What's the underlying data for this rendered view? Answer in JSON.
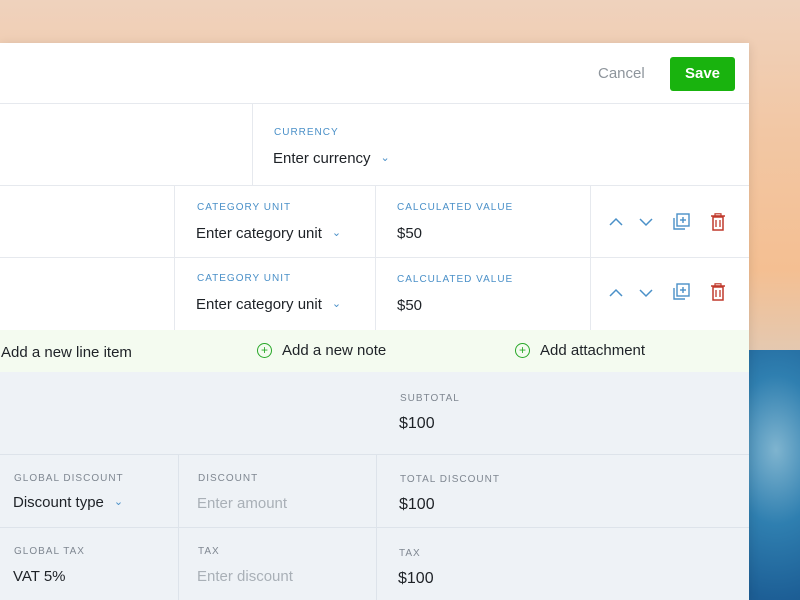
{
  "header": {
    "cancel_label": "Cancel",
    "save_label": "Save"
  },
  "currency": {
    "label": "CURRENCY",
    "value": "Enter currency"
  },
  "line_items": [
    {
      "category_unit_label": "CATEGORY UNIT",
      "category_unit_value": "Enter category unit",
      "calc_label": "CALCULATED VALUE",
      "calc_value": "$50"
    },
    {
      "category_unit_label": "CATEGORY UNIT",
      "category_unit_value": "Enter category unit",
      "calc_label": "CALCULATED VALUE",
      "calc_value": "$50"
    }
  ],
  "add_bar": {
    "line_item": "Add a new line item",
    "note": "Add a new note",
    "attachment": "Add attachment"
  },
  "totals": {
    "subtotal_label": "SUBTOTAL",
    "subtotal_value": "$100",
    "global_discount_label": "GLOBAL DISCOUNT",
    "global_discount_value": "Discount type",
    "discount_label": "DISCOUNT",
    "discount_placeholder": "Enter amount",
    "total_discount_label": "TOTAL DISCOUNT",
    "total_discount_value": "$100",
    "global_tax_label": "GLOBAL TAX",
    "global_tax_value": "VAT 5%",
    "tax_label": "TAX",
    "tax_placeholder": "Enter discount",
    "tax_total_label": "TAX",
    "tax_total_value": "$100"
  },
  "colors": {
    "accent": "#4a90c8",
    "save_green": "#19b30e",
    "delete_red": "#c0392b",
    "add_green": "#28a828"
  }
}
